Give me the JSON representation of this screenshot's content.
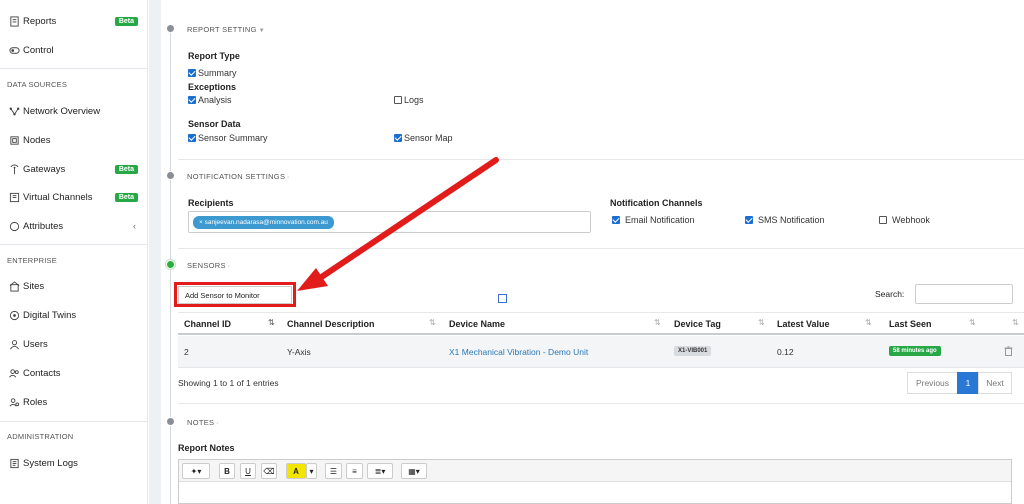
{
  "sidebar": {
    "items_top": [
      {
        "label": "Reports",
        "badge": "Beta",
        "icon": "report-icon"
      },
      {
        "label": "Control",
        "icon": "control-icon"
      }
    ],
    "data_sources_label": "DATA SOURCES",
    "data_sources": [
      {
        "label": "Network Overview",
        "icon": "network-icon"
      },
      {
        "label": "Nodes",
        "icon": "nodes-icon"
      },
      {
        "label": "Gateways",
        "badge": "Beta",
        "icon": "gateway-icon"
      },
      {
        "label": "Virtual Channels",
        "badge": "Beta",
        "icon": "virtual-channel-icon"
      },
      {
        "label": "Attributes",
        "chevron": "‹",
        "icon": "attributes-icon"
      }
    ],
    "enterprise_label": "ENTERPRISE",
    "enterprise": [
      {
        "label": "Sites",
        "icon": "sites-icon"
      },
      {
        "label": "Digital Twins",
        "icon": "digital-twins-icon"
      },
      {
        "label": "Users",
        "icon": "users-icon"
      },
      {
        "label": "Contacts",
        "icon": "contacts-icon"
      },
      {
        "label": "Roles",
        "icon": "roles-icon"
      }
    ],
    "administration_label": "ADMINISTRATION",
    "administration": [
      {
        "label": "System Logs",
        "icon": "system-logs-icon"
      }
    ]
  },
  "report_setting": {
    "title": "REPORT SETTING",
    "report_type_label": "Report Type",
    "summary": {
      "label": "Summary",
      "checked": true
    },
    "exceptions_label": "Exceptions",
    "analysis": {
      "label": "Analysis",
      "checked": true
    },
    "logs": {
      "label": "Logs",
      "checked": false
    },
    "sensor_data_label": "Sensor Data",
    "sensor_summary": {
      "label": "Sensor Summary",
      "checked": true
    },
    "sensor_map": {
      "label": "Sensor Map",
      "checked": true
    }
  },
  "notification": {
    "title": "NOTIFICATION SETTINGS",
    "recipients_label": "Recipients",
    "recipient_chip": "× sanjeevan.nadarasa@minnovation.com.au",
    "channels_label": "Notification Channels",
    "email": {
      "label": "Email Notification",
      "checked": true
    },
    "sms": {
      "label": "SMS Notification",
      "checked": true
    },
    "webhook": {
      "label": "Webhook",
      "checked": false
    }
  },
  "sensors": {
    "title": "SENSORS",
    "add_button": "Add Sensor to Monitor",
    "search_label": "Search:",
    "columns": [
      "Channel ID",
      "Channel Description",
      "Device Name",
      "Device Tag",
      "Latest Value",
      "Last Seen"
    ],
    "rows": [
      {
        "channel_id": "2",
        "description": "Y-Axis",
        "device_name": "X1 Mechanical Vibration - Demo Unit",
        "device_tag": "X1-VIB001",
        "latest_value": "0.12",
        "last_seen": "58 minutes ago"
      }
    ],
    "showing": "Showing 1 to 1 of 1 entries",
    "pager": {
      "previous": "Previous",
      "page": "1",
      "next": "Next"
    }
  },
  "notes": {
    "title": "NOTES",
    "report_notes_label": "Report Notes",
    "toolbar": {
      "bold": "B",
      "underline": "U",
      "highlight": "A"
    }
  },
  "colors": {
    "accent": "#2a78d6",
    "beta": "#27a745",
    "annotation": "#e21b1b"
  }
}
